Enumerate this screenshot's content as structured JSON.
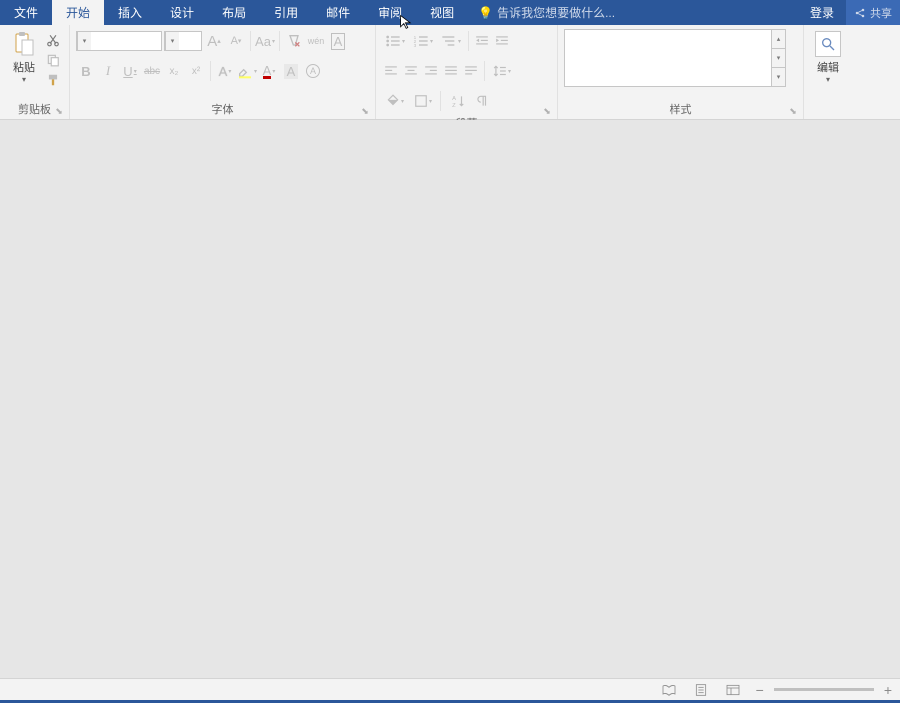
{
  "tabs": {
    "file": "文件",
    "home": "开始",
    "insert": "插入",
    "design": "设计",
    "layout": "布局",
    "references": "引用",
    "mailings": "邮件",
    "review": "审阅",
    "view": "视图"
  },
  "tellMe": {
    "placeholder": "告诉我您想要做什么..."
  },
  "account": {
    "signIn": "登录",
    "share": "共享"
  },
  "ribbon": {
    "clipboard": {
      "paste": "粘贴",
      "label": "剪贴板"
    },
    "font": {
      "label": "字体",
      "grow": "A",
      "shrink": "A",
      "changeCase": "Aa",
      "pinyin": "wén",
      "charBorder": "A",
      "bold": "B",
      "italic": "I",
      "underline": "U",
      "strike": "abc",
      "sub": "x₂",
      "sup": "x²",
      "textEffects": "A",
      "highlight": "",
      "fontColor": "A",
      "enclose": "A"
    },
    "paragraph": {
      "label": "段落"
    },
    "styles": {
      "label": "样式"
    },
    "editing": {
      "label": "编辑",
      "find": ""
    }
  },
  "launcher": "⬊",
  "caret": "▾",
  "colors": {
    "brand": "#2b579a",
    "ghost": "#bfbfbf"
  }
}
